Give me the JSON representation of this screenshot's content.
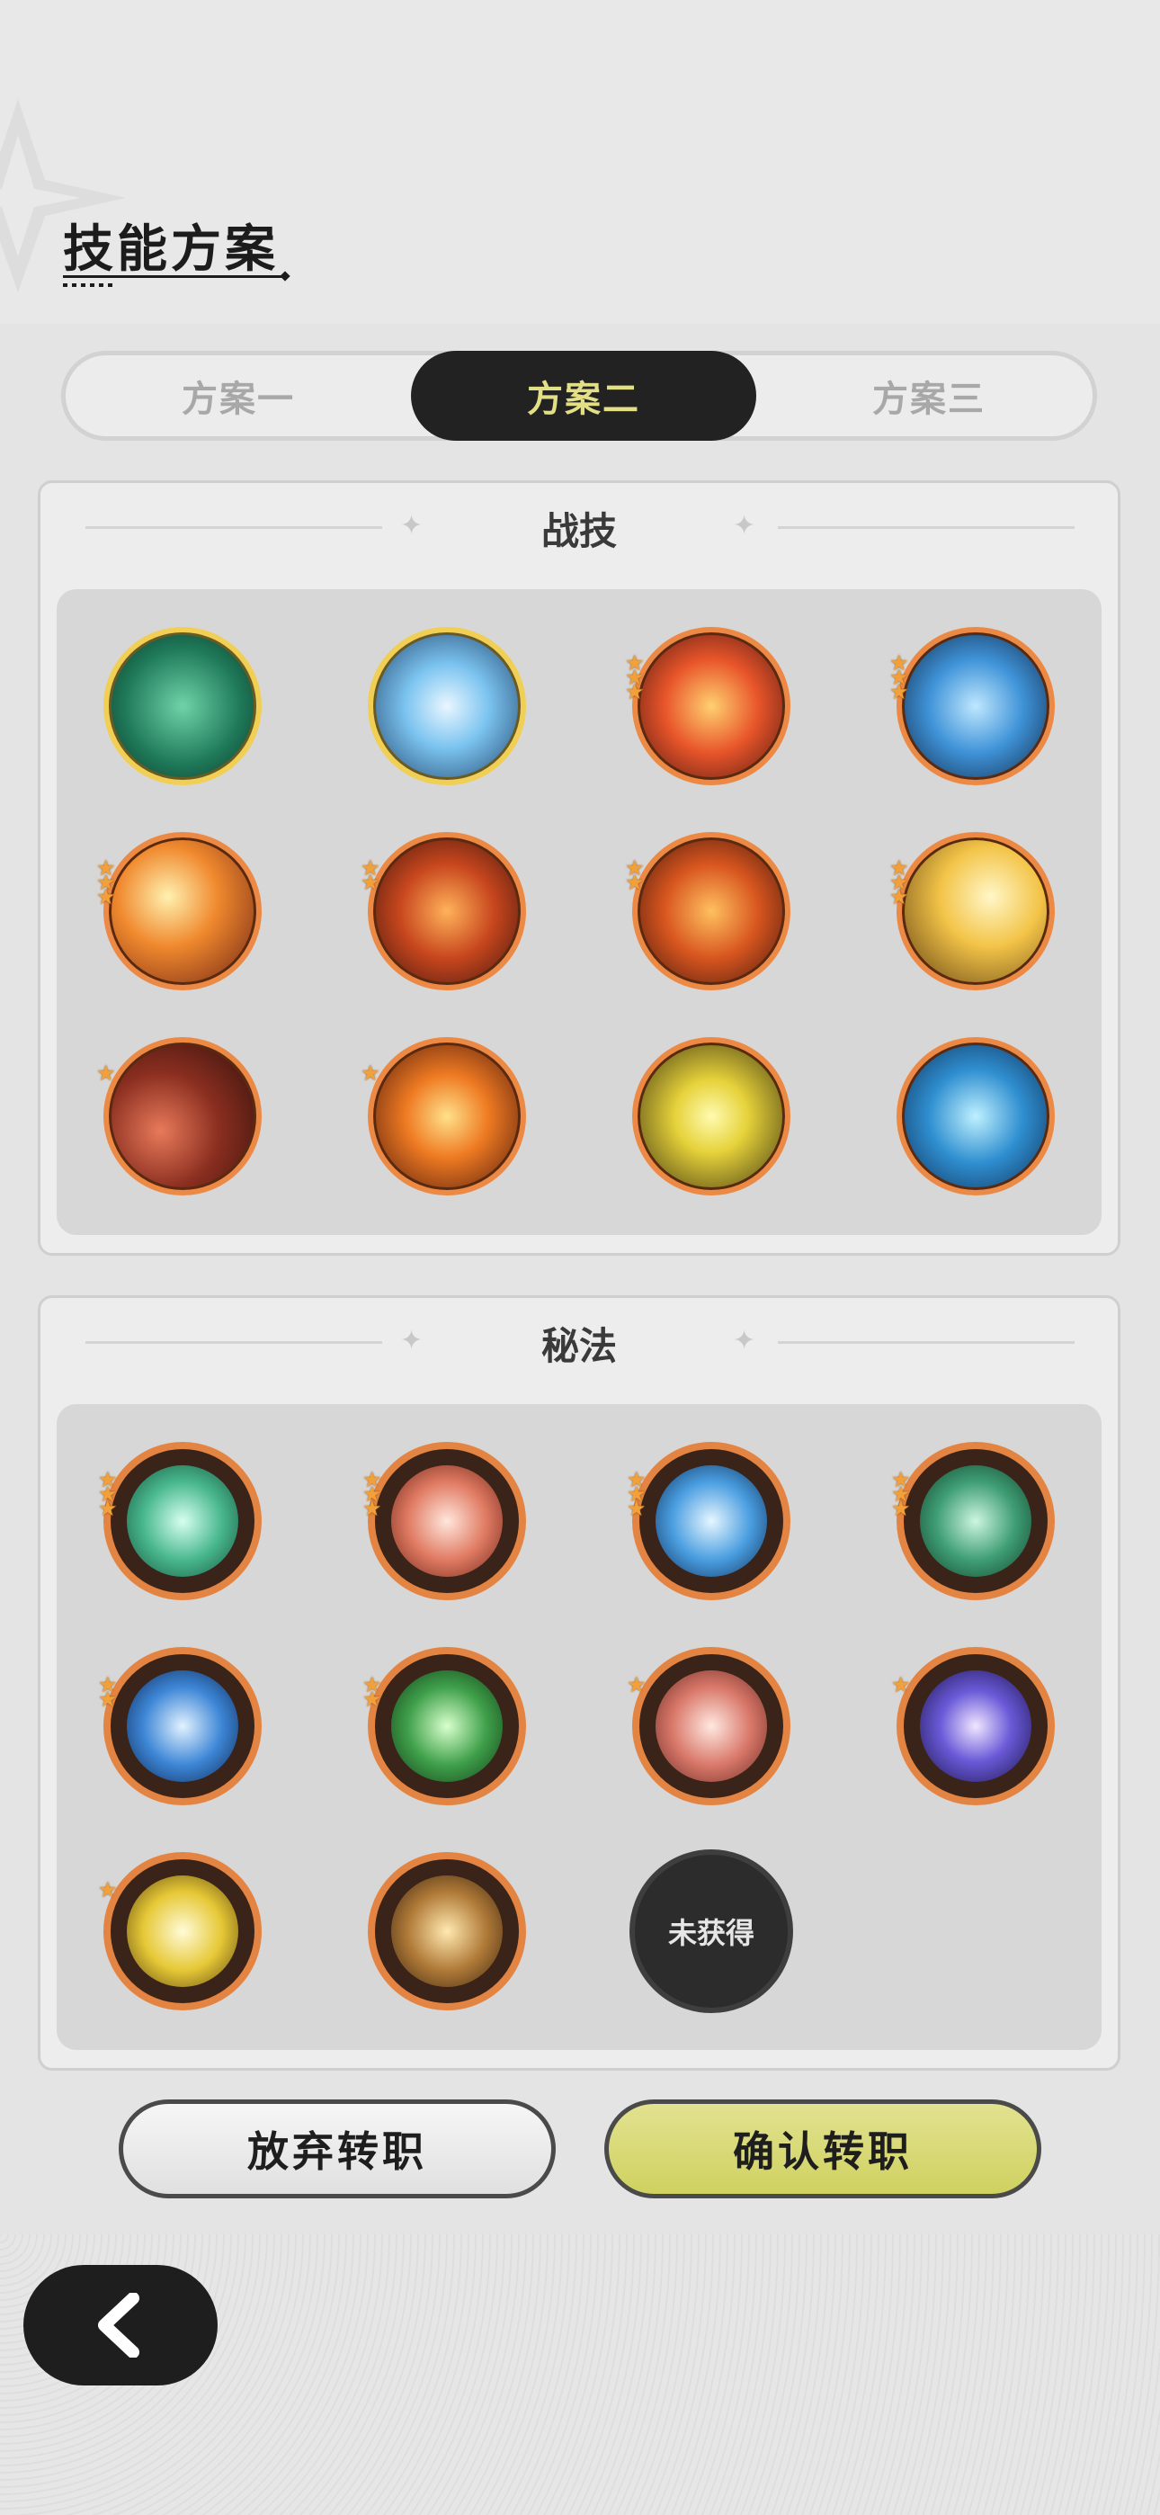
{
  "header": {
    "title": "技能方案"
  },
  "tabs": [
    {
      "label": "方案一",
      "active": false
    },
    {
      "label": "方案二",
      "active": true
    },
    {
      "label": "方案三",
      "active": false
    }
  ],
  "battle_section": {
    "title": "战技",
    "skills": [
      {
        "icon": "thorn-vine-icon",
        "frame": "gold",
        "stars": 0
      },
      {
        "icon": "ice-crystal-icon",
        "frame": "gold",
        "stars": 0
      },
      {
        "icon": "fire-spirit-icon",
        "frame": "orange",
        "stars": 3
      },
      {
        "icon": "ice-shard-icon",
        "frame": "orange",
        "stars": 3
      },
      {
        "icon": "fireball-burst-icon",
        "frame": "orange",
        "stars": 3
      },
      {
        "icon": "flame-vortex-icon",
        "frame": "orange",
        "stars": 2
      },
      {
        "icon": "flame-wave-icon",
        "frame": "orange",
        "stars": 2
      },
      {
        "icon": "star-light-icon",
        "frame": "orange",
        "stars": 3
      },
      {
        "icon": "meteor-icon",
        "frame": "orange",
        "stars": 1
      },
      {
        "icon": "fire-explosion-icon",
        "frame": "orange",
        "stars": 1
      },
      {
        "icon": "lightning-orb-icon",
        "frame": "orange",
        "stars": 0
      },
      {
        "icon": "water-whirlpool-icon",
        "frame": "orange",
        "stars": 0
      }
    ]
  },
  "secret_section": {
    "title": "秘法",
    "skills": [
      {
        "icon": "nature-burst-icon",
        "stars": 3
      },
      {
        "icon": "fire-figure-icon",
        "stars": 3
      },
      {
        "icon": "water-figure-icon",
        "stars": 3
      },
      {
        "icon": "nature-shield-icon",
        "stars": 3
      },
      {
        "icon": "ice-spike-icon",
        "stars": 2
      },
      {
        "icon": "wind-blade-icon",
        "stars": 2
      },
      {
        "icon": "flame-swirl-icon",
        "stars": 1
      },
      {
        "icon": "arcane-clock-icon",
        "stars": 1
      },
      {
        "icon": "light-figure-icon",
        "stars": 1
      },
      {
        "icon": "starlight-wand-icon",
        "stars": 0
      }
    ],
    "locked_label": "未获得"
  },
  "buttons": {
    "abandon": "放弃转职",
    "confirm": "确认转职"
  },
  "colors": {
    "tab_active_bg": "#222222",
    "tab_active_text": "#e3df86",
    "confirm_bg": "#d8d873",
    "frame_gold": "#f1cf55",
    "frame_orange": "#ec8a45"
  }
}
